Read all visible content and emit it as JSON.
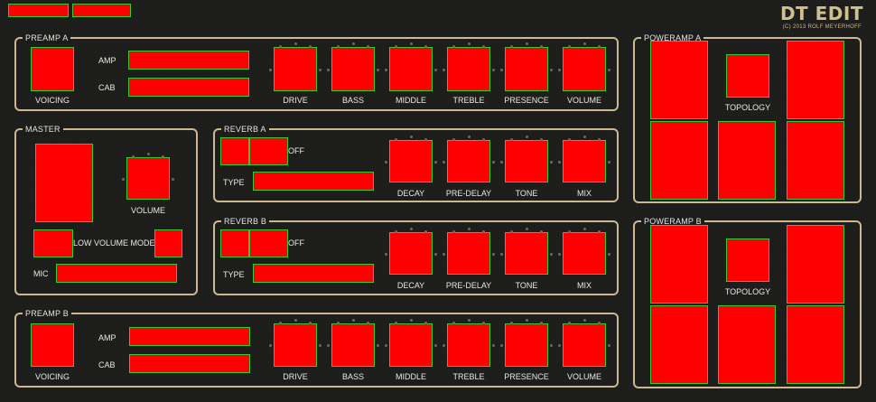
{
  "app": {
    "title": "DT EDIT",
    "copyright": "(C) 2013 ROLF MEYERHOFF"
  },
  "preamp_a": {
    "title": "PREAMP A",
    "voicing_label": "VOICING",
    "amp_label": "AMP",
    "cab_label": "CAB",
    "knobs": [
      "DRIVE",
      "BASS",
      "MIDDLE",
      "TREBLE",
      "PRESENCE",
      "VOLUME"
    ]
  },
  "preamp_b": {
    "title": "PREAMP B",
    "voicing_label": "VOICING",
    "amp_label": "AMP",
    "cab_label": "CAB",
    "knobs": [
      "DRIVE",
      "BASS",
      "MIDDLE",
      "TREBLE",
      "PRESENCE",
      "VOLUME"
    ]
  },
  "master": {
    "title": "MASTER",
    "volume_label": "VOLUME",
    "low_volume_mode_label": "LOW VOLUME MODE",
    "mic_label": "MIC"
  },
  "reverb_a": {
    "title": "REVERB A",
    "off_label": "OFF",
    "type_label": "TYPE",
    "knobs": [
      "DECAY",
      "PRE-DELAY",
      "TONE",
      "MIX"
    ]
  },
  "reverb_b": {
    "title": "REVERB B",
    "off_label": "OFF",
    "type_label": "TYPE",
    "knobs": [
      "DECAY",
      "PRE-DELAY",
      "TONE",
      "MIX"
    ]
  },
  "poweramp_a": {
    "title": "POWERAMP A",
    "topology_label": "TOPOLOGY"
  },
  "poweramp_b": {
    "title": "POWERAMP B",
    "topology_label": "TOPOLOGY"
  },
  "colors": {
    "control": "#ff0000",
    "control_border": "#35c83a",
    "panel_border": "#cdb892",
    "background": "#1c1c1a"
  }
}
